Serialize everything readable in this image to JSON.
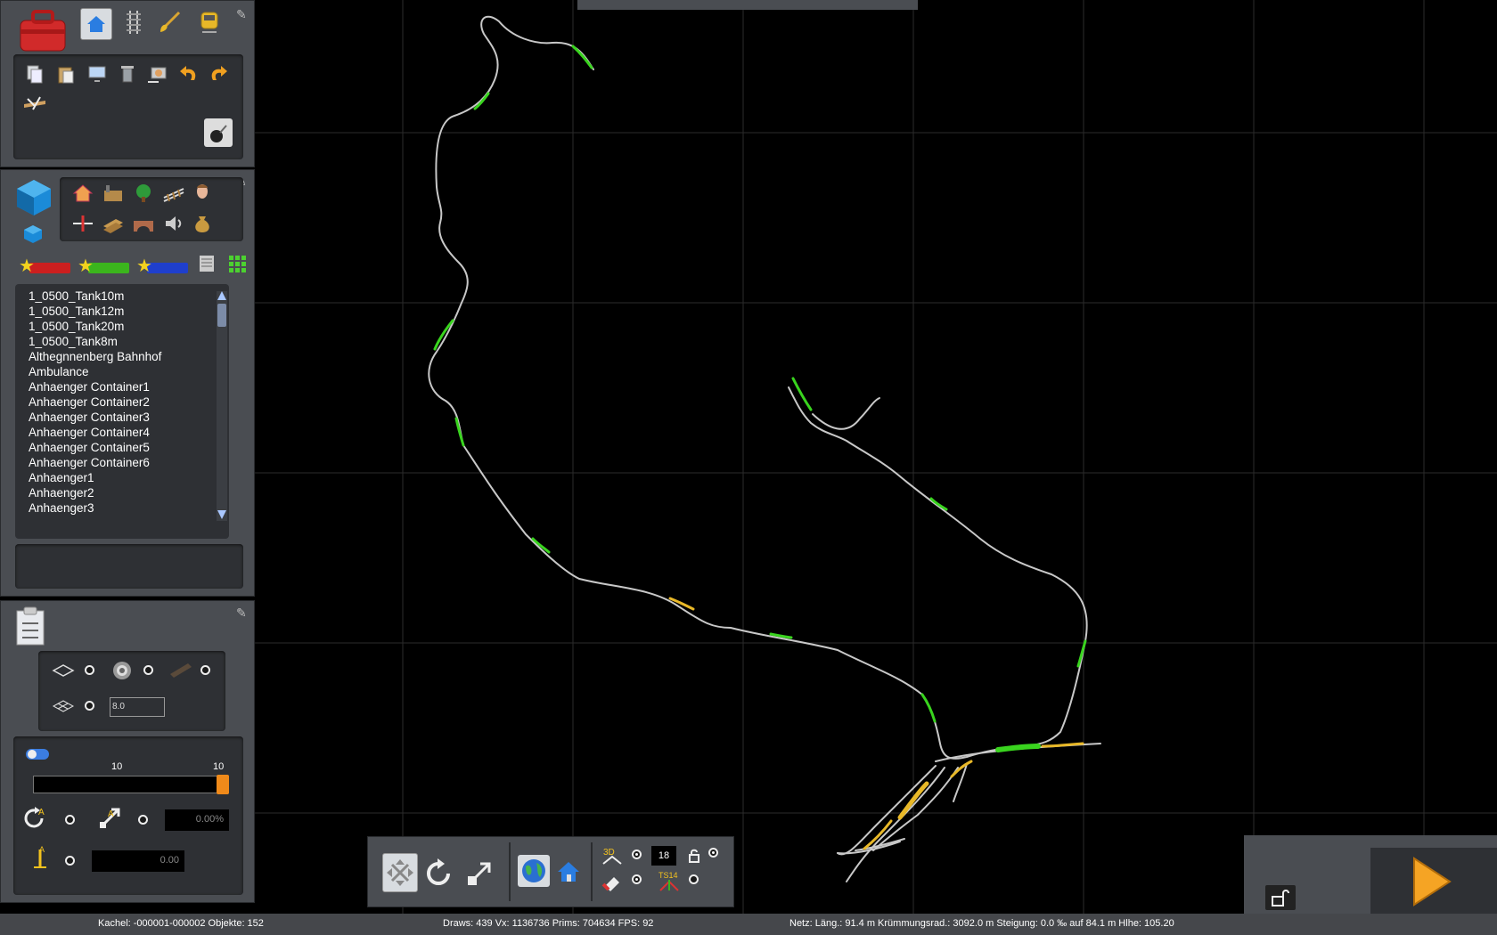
{
  "map": {
    "background": "#000000",
    "grid_color": "#2b2b2b",
    "track_color": "#c8c8c8",
    "highlight_green": "#39d41e",
    "highlight_yellow": "#e8b828"
  },
  "toolbox": {
    "icons": [
      "toolbox-icon",
      "home-icon",
      "track-icon",
      "brush-icon",
      "train-icon"
    ],
    "edit_icons": [
      "copy-icon",
      "paste-icon",
      "monitor-icon",
      "trash-icon",
      "screen-icon",
      "undo-icon",
      "redo-icon",
      "bridge-tool-icon"
    ]
  },
  "objects_panel": {
    "category_icons": [
      "house-icon",
      "factory-icon",
      "tree-icon",
      "rail-icon",
      "person-icon",
      "signal-icon",
      "planks-icon",
      "bridge-icon",
      "speaker-icon",
      "sack-icon"
    ],
    "items": [
      "1_0500_Tank10m",
      "1_0500_Tank12m",
      "1_0500_Tank20m",
      "1_0500_Tank8m",
      "Althegnnenberg Bahnhof",
      "Ambulance",
      "Anhaenger Container1",
      "Anhaenger Container2",
      "Anhaenger Container3",
      "Anhaenger Container4",
      "Anhaenger Container5",
      "Anhaenger Container6",
      "Anhaenger1",
      "Anhaenger2",
      "Anhaenger3"
    ]
  },
  "properties_panel": {
    "grid_value": "8.0",
    "slider_min_label": "10",
    "slider_max_label": "10",
    "slope_value": "0.00%",
    "height_value": "0.00"
  },
  "bottom_toolbar": {
    "number_value": "18",
    "label_3d": "3D",
    "label_ts": "TS14"
  },
  "status": {
    "tile": "Kachel: -000001-000002  Objekte: 152",
    "draws": "Draws: 439 Vx: 1136736 Prims: 704634 FPS: 92",
    "net": "Netz:  Läng.:   91.4 m Krümmungsrad.: 3092.0 m Steigung:  0.0 ‰ auf 84.1 m Hlhe: 105.20"
  }
}
